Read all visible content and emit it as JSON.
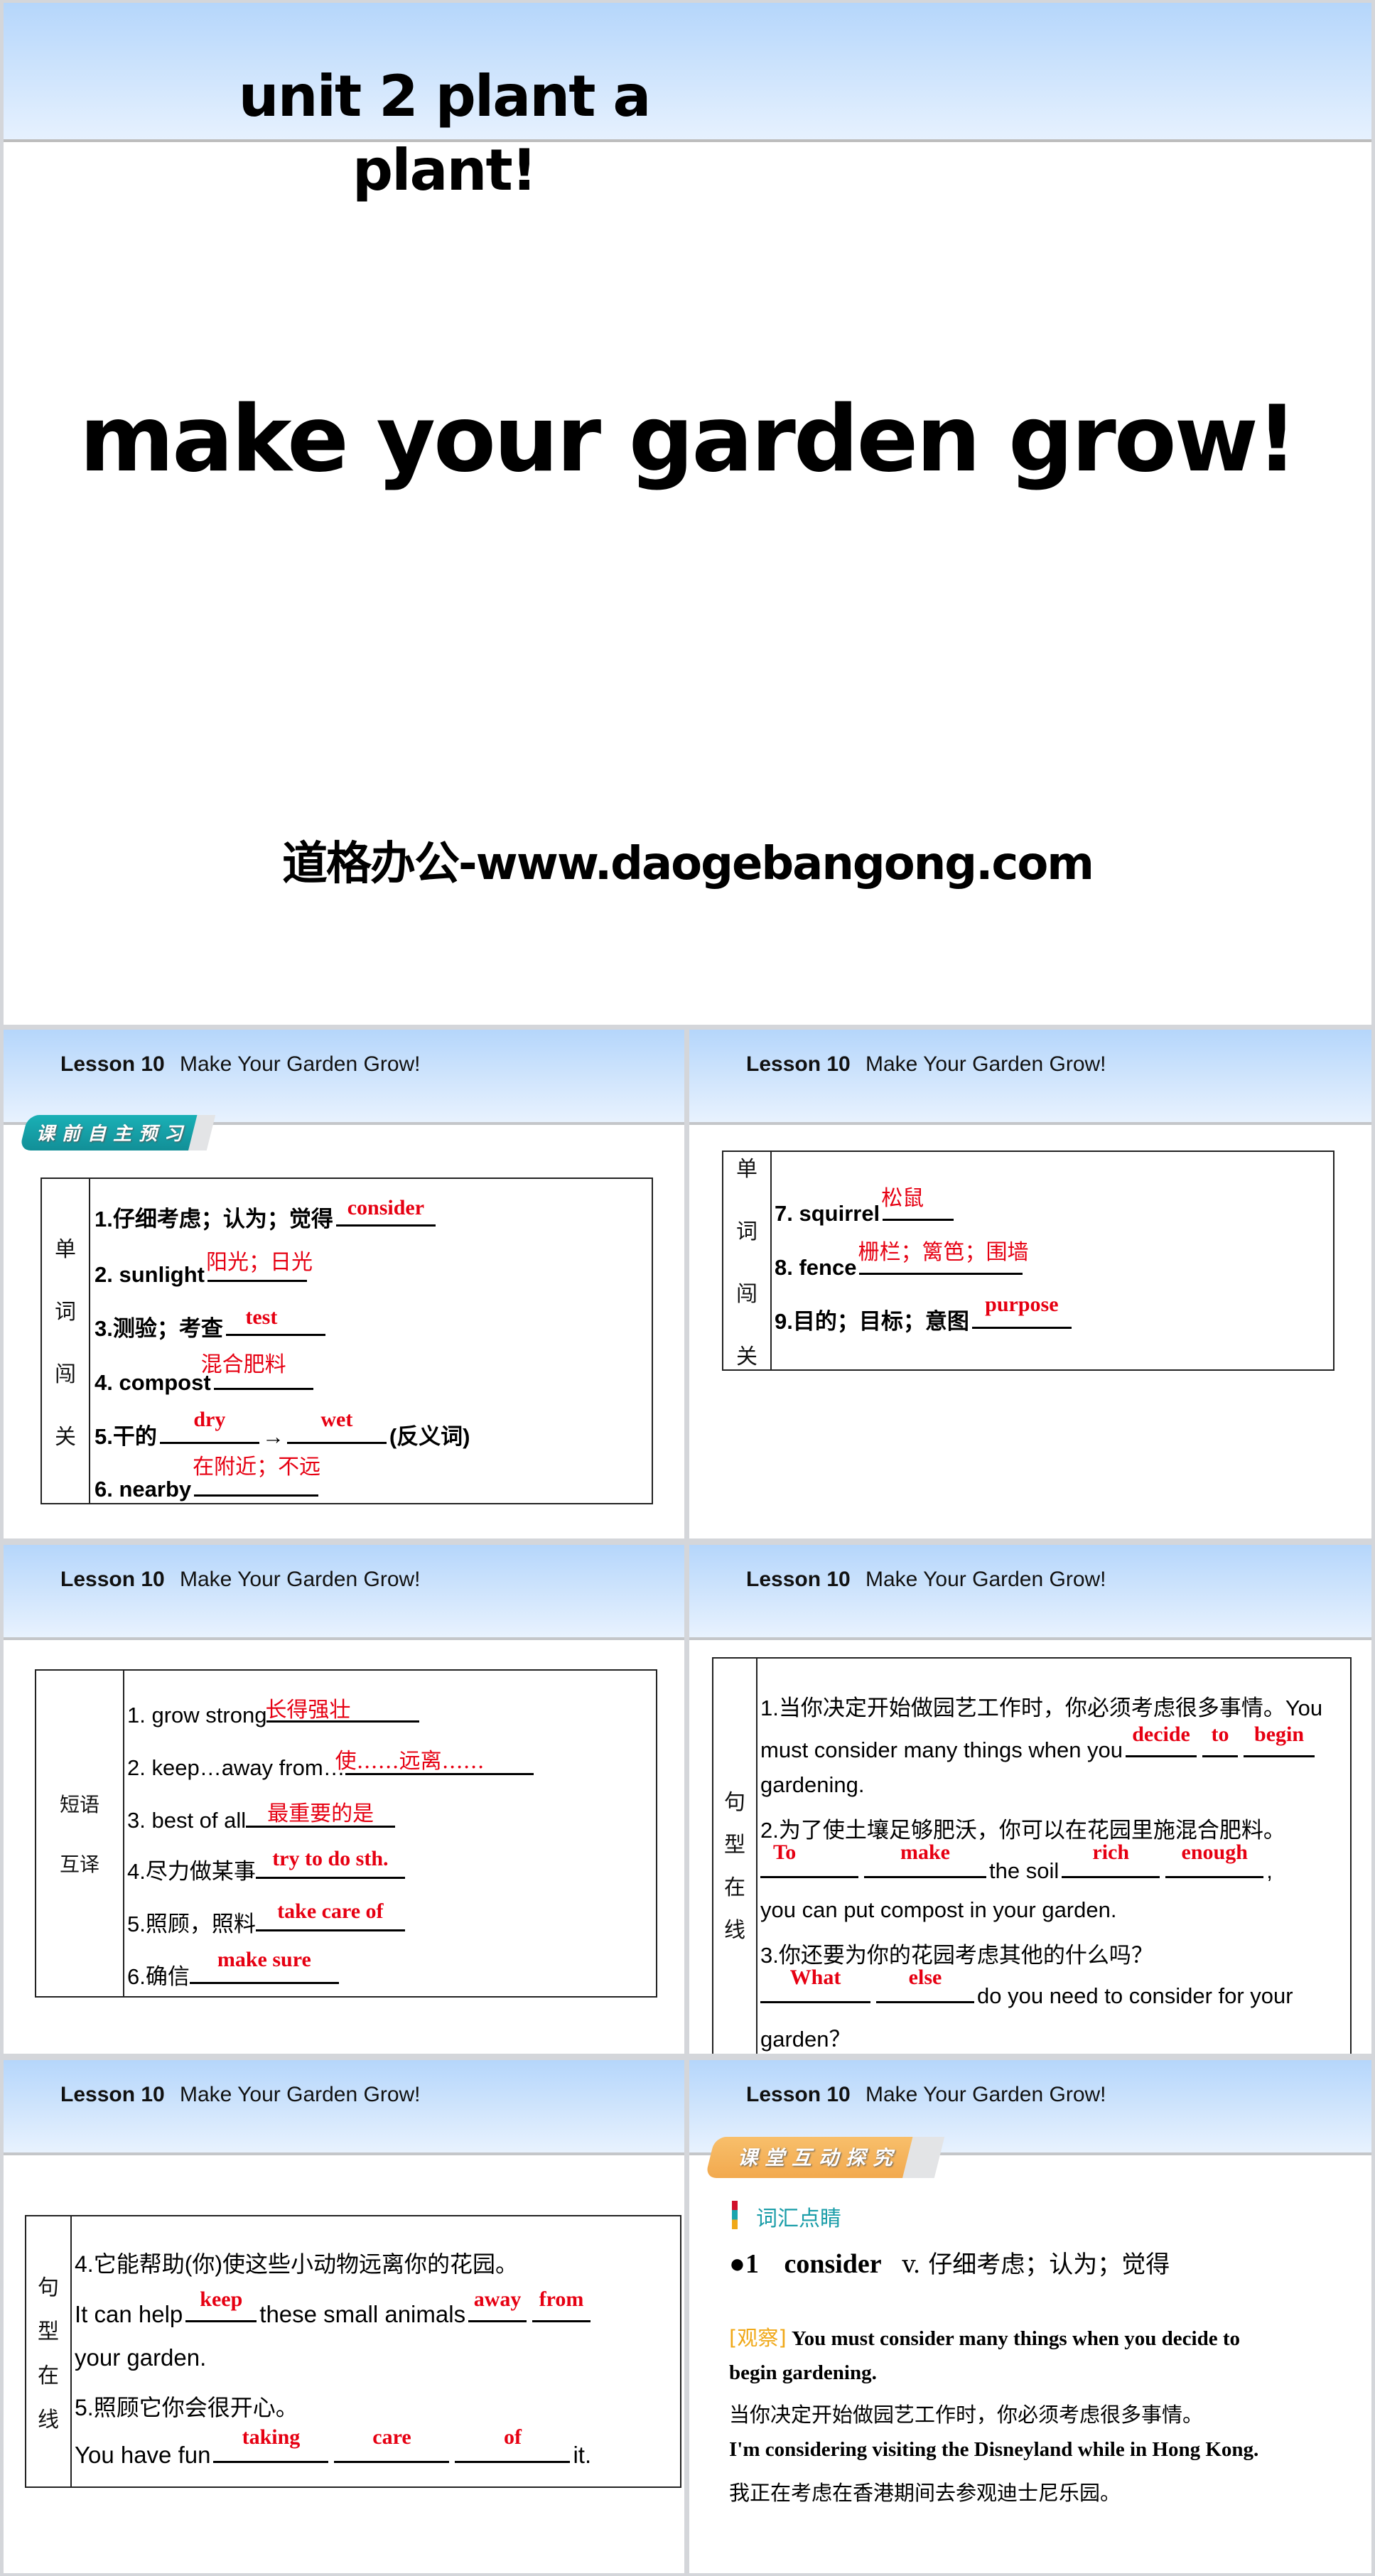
{
  "title_slide": {
    "unit_title": "unit 2  plant a plant!",
    "main_title": "make your garden grow!",
    "site": "道格办公-www.daogebangong.com"
  },
  "lesson_header": {
    "number": "Lesson 10",
    "title": "Make Your Garden Grow!"
  },
  "slide2": {
    "badge": "课前自主预习",
    "side_label": [
      "单",
      "词",
      "闯",
      "关"
    ],
    "items": [
      {
        "prompt": "1.仔细考虑；认为；觉得",
        "answer": "consider"
      },
      {
        "prompt": "2. sunlight",
        "answer": "阳光；日光"
      },
      {
        "prompt": "3.测验；考查",
        "answer": "test"
      },
      {
        "prompt": "4. compost",
        "answer": "混合肥料"
      },
      {
        "prompt": "5.干的",
        "answer": "dry",
        "arrow": "→",
        "answer2": "wet",
        "suffix": "(反义词)"
      },
      {
        "prompt": "6. nearby",
        "answer": "在附近；不远"
      }
    ]
  },
  "slide3": {
    "side_label": [
      "单",
      "词",
      "闯",
      "关"
    ],
    "items": [
      {
        "prompt": "7. squirrel",
        "answer": "松鼠"
      },
      {
        "prompt": "8. fence",
        "answer": "栅栏；篱笆；围墙"
      },
      {
        "prompt": "9.目的；目标；意图",
        "answer": "purpose"
      }
    ]
  },
  "slide4": {
    "side_label": [
      "短语",
      "互译"
    ],
    "items": [
      {
        "prompt": "1.   grow strong",
        "answer": "长得强壮"
      },
      {
        "prompt": "2.   keep…away from…",
        "answer": "使……远离……"
      },
      {
        "prompt": "3. best of all",
        "answer": "最重要的是"
      },
      {
        "prompt": "4.尽力做某事",
        "answer": "try to do sth."
      },
      {
        "prompt": "5.照顾，照料",
        "answer": "take care of"
      },
      {
        "prompt": "6.确信",
        "answer": "make sure"
      }
    ]
  },
  "slide5": {
    "side_label": [
      "句",
      "型",
      "在",
      "线"
    ],
    "s1_cn": "1.当你决定开始做园艺工作时，你必须考虑很多事情。You",
    "s1_en_a": "must consider many things when you",
    "s1_answers": [
      "decide",
      "to",
      "begin"
    ],
    "s1_en_b": "gardening.",
    "s2_cn": "2.为了使土壤足够肥沃，你可以在花园里施混合肥料。",
    "s2_answers_a": [
      "To",
      "make"
    ],
    "s2_mid": "the soil",
    "s2_answers_b": [
      "rich",
      "enough"
    ],
    "s2_comma": ",",
    "s2_en_b": "you can put compost in your garden.",
    "s3_cn": "3.你还要为你的花园考虑其他的什么吗？",
    "s3_answers": [
      "What",
      "else"
    ],
    "s3_en_a": "do you need to consider for your",
    "s3_en_b": "garden？"
  },
  "slide6": {
    "side_label": [
      "句",
      "型",
      "在",
      "线"
    ],
    "s4_cn": "4.它能帮助(你)使这些小动物远离你的花园。",
    "s4_en_a": "It can help",
    "s4_ans1": "keep",
    "s4_en_mid": "these small animals",
    "s4_ans2": [
      "away",
      "from"
    ],
    "s4_en_b": "your garden.",
    "s5_cn": "5.照顾它你会很开心。",
    "s5_en_a": "You have fun",
    "s5_answers": [
      "taking",
      "care",
      "of"
    ],
    "s5_en_b": "it."
  },
  "slide7": {
    "badge": "课堂互动探究",
    "section": "词汇点睛",
    "entry_num": "●1",
    "entry_word": "consider",
    "entry_def": "v. 仔细考虑；认为；觉得",
    "observe_tag": "[观察]",
    "ex1_en": "You must consider many things when you decide to",
    "ex1_en_b": "begin gardening.",
    "ex1_cn": "当你决定开始做园艺工作时，你必须考虑很多事情。",
    "ex2_en": "I'm considering visiting the Disneyland while in Hong Kong.",
    "ex2_cn": "我正在考虑在香港期间去参观迪士尼乐园。"
  },
  "colors": {
    "answer_red": "#e60012",
    "teal_badge": "#17a1a8",
    "orange_badge": "#f6b35b",
    "section_teal": "#1a9da8",
    "observe_orange": "#f0a818"
  }
}
